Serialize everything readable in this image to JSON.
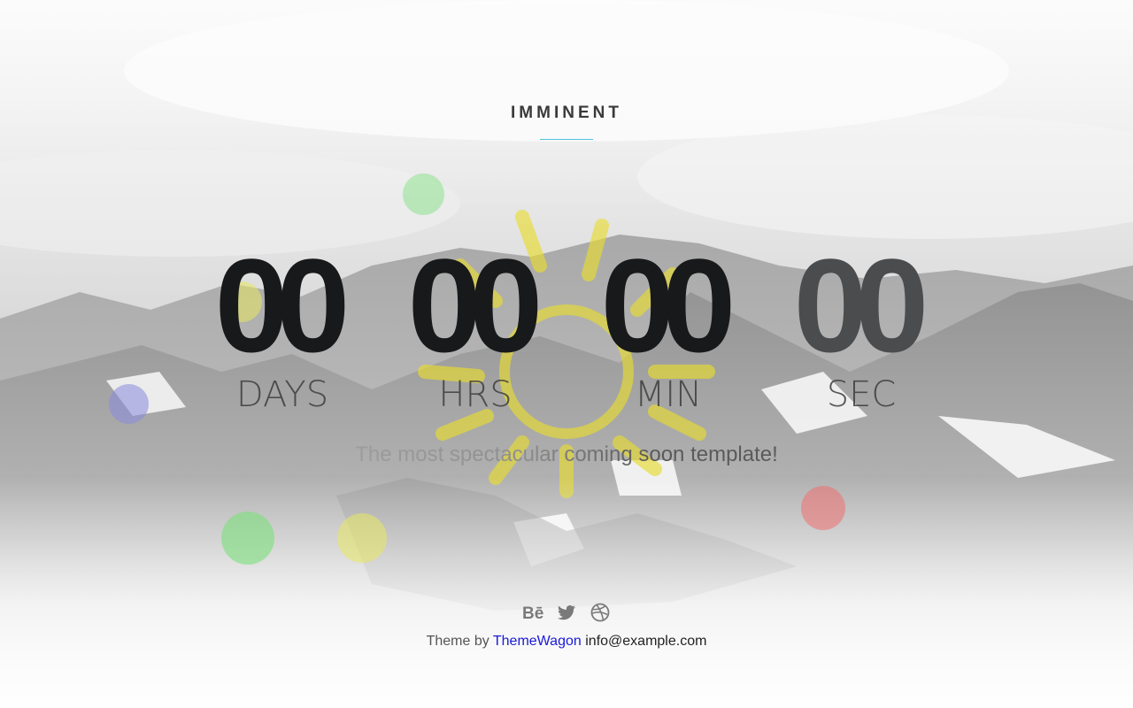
{
  "brand": {
    "title": "IMMINENT",
    "accent_color": "#4fc3d9"
  },
  "countdown": {
    "units": [
      {
        "value": "00",
        "label": "DAYS"
      },
      {
        "value": "00",
        "label": "HRS"
      },
      {
        "value": "00",
        "label": "MIN"
      },
      {
        "value": "00",
        "label": "SEC"
      }
    ]
  },
  "tagline": "The most spectacular coming soon template!",
  "social": {
    "icons": [
      "behance-icon",
      "twitter-icon",
      "dribbble-icon"
    ],
    "icon_color": "#7a7a7a"
  },
  "footer": {
    "prefix": "Theme by",
    "link_text": "ThemeWagon",
    "email": "info@example.com",
    "link_color": "#1a1ad6"
  },
  "decor": {
    "bubble_colors": [
      "#7be07b",
      "#e8e860",
      "#8a8ae0",
      "#f07070"
    ]
  }
}
